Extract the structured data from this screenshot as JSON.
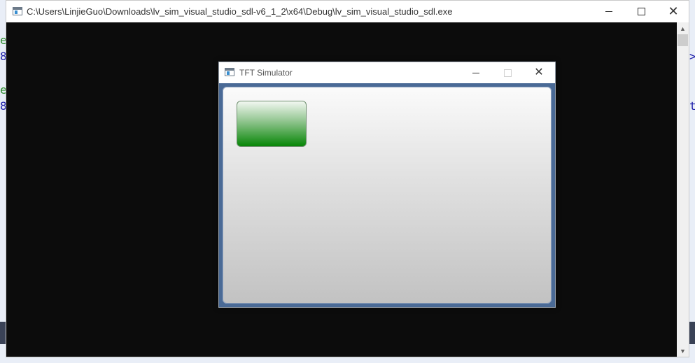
{
  "console": {
    "title": "C:\\Users\\LinjieGuo\\Downloads\\lv_sim_visual_studio_sdl-v6_1_2\\x64\\Debug\\lv_sim_visual_studio_sdl.exe",
    "icon": "console-app-icon"
  },
  "background_fragments": {
    "left": [
      "e",
      "8",
      "e",
      "8"
    ],
    "right": [
      ">",
      "t"
    ]
  },
  "tft": {
    "title": "TFT Simulator",
    "icon": "app-icon",
    "button_colors": {
      "top": "#f2f7f1",
      "bottom": "#078607"
    },
    "frame_color": "#4a6a96"
  }
}
